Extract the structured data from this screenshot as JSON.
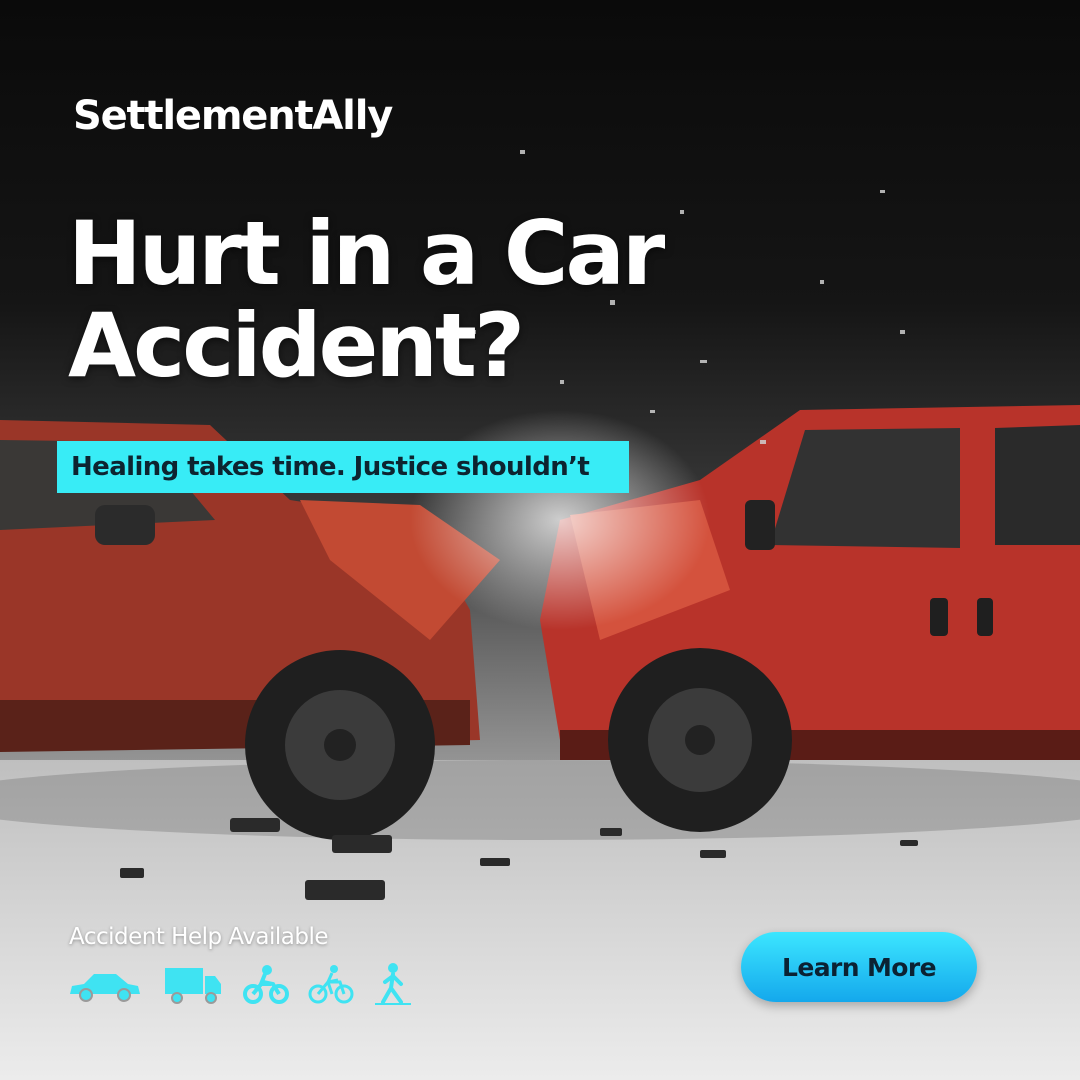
{
  "brand": {
    "name": "SettlementAlly"
  },
  "hero": {
    "headline_line1": "Hurt in a Car",
    "headline_line2": "Accident?",
    "tagline": "Healing takes time. Justice shouldn’t"
  },
  "footer": {
    "help_label": "Accident Help Available",
    "icons": [
      "car-icon",
      "truck-icon",
      "motorcycle-icon",
      "bicycle-icon",
      "pedestrian-icon"
    ],
    "cta_label": "Learn More"
  },
  "colors": {
    "accent": "#38ecf6",
    "cta_gradient_top": "#3ce6ff",
    "cta_gradient_bottom": "#14a8ec",
    "icon_color": "#3fe3f2",
    "truck_red": "#b8332a",
    "pickup_red": "#9a3628"
  }
}
